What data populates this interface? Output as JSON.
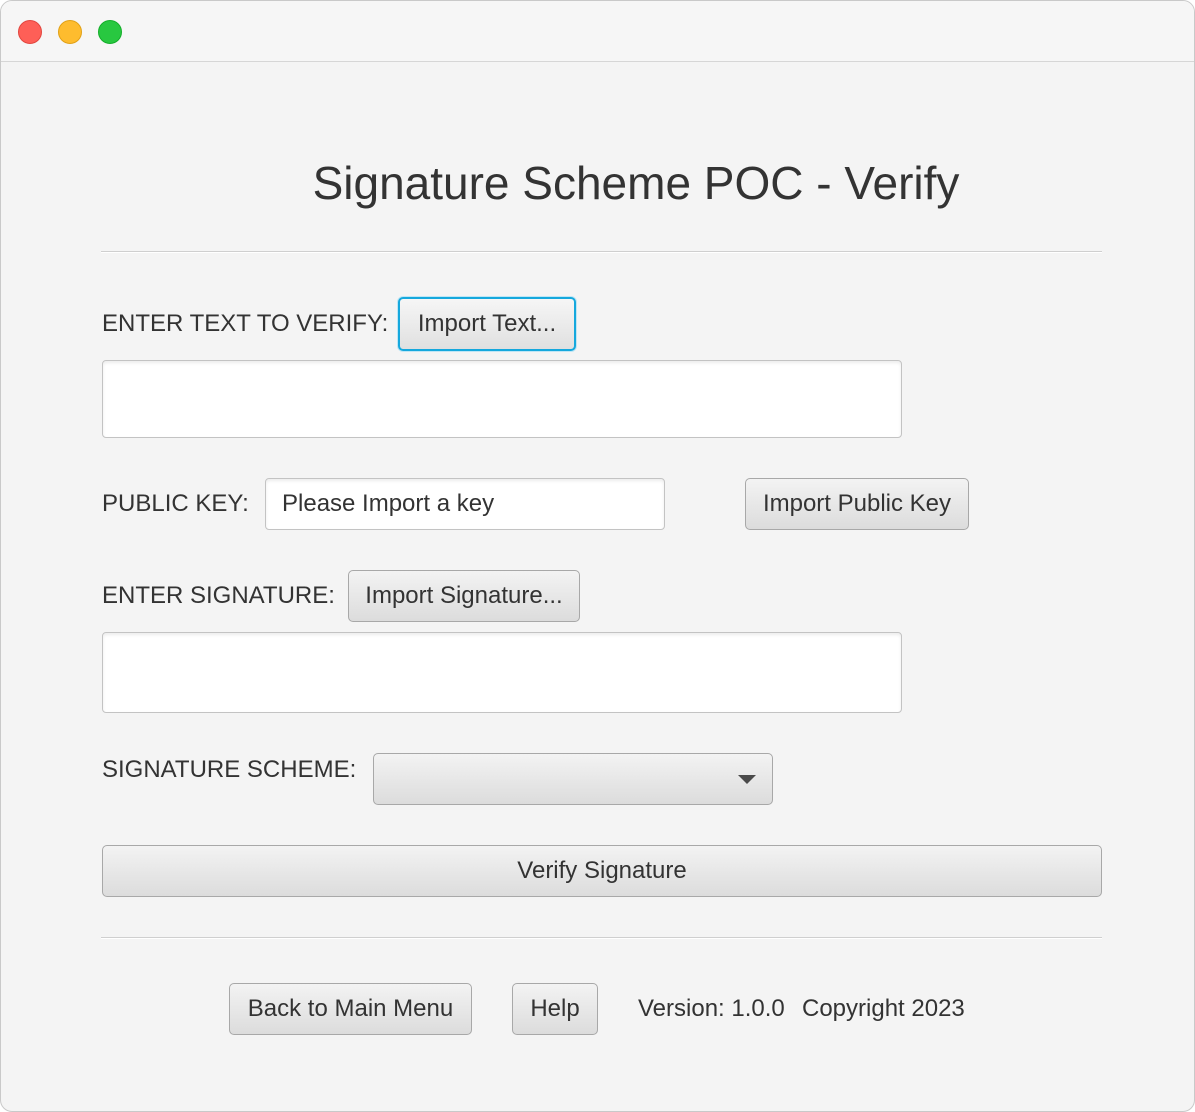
{
  "window": {
    "controls": [
      "close",
      "minimize",
      "zoom"
    ]
  },
  "page": {
    "title": "Signature Scheme POC - Verify"
  },
  "text_section": {
    "label": "ENTER TEXT TO VERIFY:",
    "import_button": "Import Text...",
    "value": ""
  },
  "public_key": {
    "label": "PUBLIC KEY:",
    "value": "Please Import a key",
    "import_button": "Import Public Key"
  },
  "signature_section": {
    "label": "ENTER SIGNATURE:",
    "import_button": "Import Signature...",
    "value": ""
  },
  "scheme": {
    "label": "SIGNATURE SCHEME:",
    "selected": ""
  },
  "verify_button": "Verify Signature",
  "footer": {
    "back_button": "Back to Main Menu",
    "help_button": "Help",
    "version": "Version: 1.0.0",
    "copyright": "Copyright 2023"
  },
  "colors": {
    "background": "#f4f4f4",
    "focus_ring": "#15a8dd",
    "text": "#333333"
  }
}
